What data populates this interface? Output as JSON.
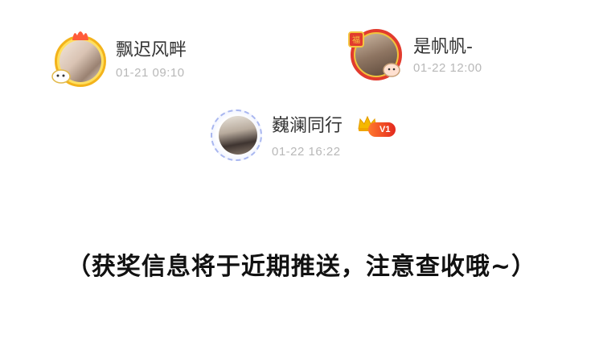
{
  "winners": [
    {
      "name": "飘迟风畔",
      "time": "01-21 09:10"
    },
    {
      "name": "是帆帆-",
      "time": "01-22 12:00"
    },
    {
      "name": "巍澜同行",
      "time": "01-22 16:22",
      "vip_label": "V1"
    }
  ],
  "notice": "（获奖信息将于近期推送，注意查收哦~）",
  "colors": {
    "name": "#333333",
    "time": "#b8b8b8",
    "vip_badge": "#e3281e",
    "crown": "#f5b800"
  }
}
